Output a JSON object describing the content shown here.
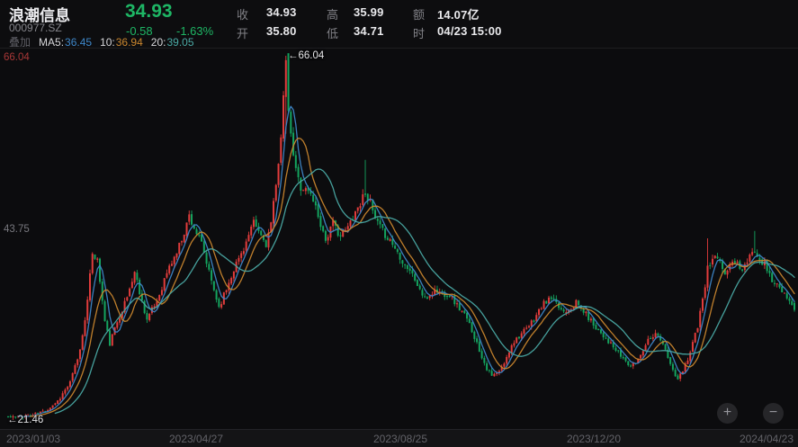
{
  "header": {
    "name": "浪潮信息",
    "code": "000977.SZ",
    "price": "34.93",
    "change": "-0.58",
    "change_pct": "-1.63%",
    "stats": {
      "close": {
        "label": "收",
        "value": "34.93"
      },
      "open": {
        "label": "开",
        "value": "35.80"
      },
      "high": {
        "label": "高",
        "value": "35.99"
      },
      "low": {
        "label": "低",
        "value": "34.71"
      },
      "amount": {
        "label": "额",
        "value": "14.07亿"
      },
      "time": {
        "label": "时",
        "value": "04/23 15:00"
      }
    },
    "ma": {
      "overlay": "叠加",
      "m5_label": "MA5:",
      "m5_value": "36.45",
      "m10_label": "10:",
      "m10_value": "36.94",
      "m20_label": "20:",
      "m20_value": "39.05"
    }
  },
  "controls": {
    "zoom_in": "+",
    "zoom_out": "−"
  },
  "theme": {
    "background": "#0c0c0e",
    "up_color": "#e23c3c",
    "down_color": "#14a45f",
    "price_green": "#1eb665",
    "axis_red": "#a83737",
    "axis_gray": "#626268"
  },
  "chart_data": {
    "type": "candlestick",
    "symbol": "000977.SZ",
    "title": "浪潮信息 daily K-line with MA5/MA10/MA20",
    "date_range": [
      "2023/01/03",
      "2024/04/23"
    ],
    "x_ticks": [
      "2023/01/03",
      "2023/04/27",
      "2023/08/25",
      "2023/12/20",
      "2024/04/23"
    ],
    "y_labels": {
      "max": "66.04",
      "mid": "43.75",
      "min": "21.46"
    },
    "annotations": {
      "high": "←66.04",
      "low": "←21.46"
    },
    "period_high": 66.04,
    "period_low": 21.46,
    "price_range": [
      21.46,
      66.04
    ],
    "days": 318,
    "seed": 11,
    "legend_position": "top-left",
    "grid": false,
    "anchors": [
      [
        0,
        21.9
      ],
      [
        4,
        21.8
      ],
      [
        10,
        22.1
      ],
      [
        15,
        22.6
      ],
      [
        20,
        23.8
      ],
      [
        25,
        26.0
      ],
      [
        29,
        30.0
      ],
      [
        32,
        36.0
      ],
      [
        34,
        42.0
      ],
      [
        36,
        41.0
      ],
      [
        39,
        33.5
      ],
      [
        41,
        30.8
      ],
      [
        44,
        33.5
      ],
      [
        48,
        36.5
      ],
      [
        51,
        39.6
      ],
      [
        54,
        36.0
      ],
      [
        56,
        33.8
      ],
      [
        60,
        36.0
      ],
      [
        64,
        39.5
      ],
      [
        68,
        42.0
      ],
      [
        71,
        44.5
      ],
      [
        73,
        46.5
      ],
      [
        75,
        45.0
      ],
      [
        78,
        43.0
      ],
      [
        81,
        39.5
      ],
      [
        85,
        35.3
      ],
      [
        88,
        37.5
      ],
      [
        91,
        40.0
      ],
      [
        95,
        42.5
      ],
      [
        99,
        45.5
      ],
      [
        101,
        44.5
      ],
      [
        104,
        43.0
      ],
      [
        106,
        45.5
      ],
      [
        108,
        50.0
      ],
      [
        110,
        56.5
      ],
      [
        111,
        61.0
      ],
      [
        112,
        65.5
      ],
      [
        113,
        59.5
      ],
      [
        114,
        56.0
      ],
      [
        116,
        52.0
      ],
      [
        118,
        50.0
      ],
      [
        121,
        49.5
      ],
      [
        123,
        48.5
      ],
      [
        125,
        46.5
      ],
      [
        128,
        43.5
      ],
      [
        131,
        45.5
      ],
      [
        134,
        44.0
      ],
      [
        137,
        45.0
      ],
      [
        139,
        46.5
      ],
      [
        142,
        48.0
      ],
      [
        144,
        49.5
      ],
      [
        146,
        48.0
      ],
      [
        148,
        46.0
      ],
      [
        151,
        44.5
      ],
      [
        154,
        43.5
      ],
      [
        157,
        42.0
      ],
      [
        160,
        40.5
      ],
      [
        162,
        39.8
      ],
      [
        165,
        38.0
      ],
      [
        168,
        36.2
      ],
      [
        172,
        37.3
      ],
      [
        175,
        37.0
      ],
      [
        178,
        36.8
      ],
      [
        181,
        35.5
      ],
      [
        184,
        34.3
      ],
      [
        187,
        32.5
      ],
      [
        190,
        30.0
      ],
      [
        193,
        27.8
      ],
      [
        195,
        26.8
      ],
      [
        198,
        27.3
      ],
      [
        201,
        29.0
      ],
      [
        203,
        30.8
      ],
      [
        206,
        31.8
      ],
      [
        209,
        32.5
      ],
      [
        212,
        33.8
      ],
      [
        215,
        35.3
      ],
      [
        217,
        36.0
      ],
      [
        219,
        36.3
      ],
      [
        221,
        35.5
      ],
      [
        224,
        34.8
      ],
      [
        227,
        35.3
      ],
      [
        229,
        35.8
      ],
      [
        232,
        34.8
      ],
      [
        234,
        34.0
      ],
      [
        236,
        33.2
      ],
      [
        238,
        32.5
      ],
      [
        241,
        31.5
      ],
      [
        244,
        30.3
      ],
      [
        247,
        29.3
      ],
      [
        251,
        28.0
      ],
      [
        253,
        28.5
      ],
      [
        255,
        29.5
      ],
      [
        257,
        30.8
      ],
      [
        259,
        31.8
      ],
      [
        262,
        32.0
      ],
      [
        264,
        30.8
      ],
      [
        266,
        29.0
      ],
      [
        268,
        27.5
      ],
      [
        270,
        26.3
      ],
      [
        272,
        27.5
      ],
      [
        274,
        29.0
      ],
      [
        276,
        31.0
      ],
      [
        278,
        33.0
      ],
      [
        280,
        36.0
      ],
      [
        282,
        40.0
      ],
      [
        284,
        41.0
      ],
      [
        285,
        41.5
      ],
      [
        287,
        40.5
      ],
      [
        289,
        39.5
      ],
      [
        291,
        40.3
      ],
      [
        293,
        41.0
      ],
      [
        295,
        40.3
      ],
      [
        296,
        39.8
      ],
      [
        298,
        40.8
      ],
      [
        301,
        42.3
      ],
      [
        303,
        41.3
      ],
      [
        305,
        40.5
      ],
      [
        307,
        39.3
      ],
      [
        308,
        38.5
      ],
      [
        310,
        38.0
      ],
      [
        312,
        37.0
      ],
      [
        314,
        36.3
      ],
      [
        315,
        35.8
      ],
      [
        316,
        35.5
      ],
      [
        317,
        34.93
      ]
    ],
    "key_candles": [
      {
        "day": 2,
        "l": 21.46
      },
      {
        "day": 112,
        "o": 61.0,
        "c": 65.5,
        "h": 66.04,
        "l": 56.5
      },
      {
        "day": 144,
        "h": 53.3
      },
      {
        "day": 282,
        "h": 43.7
      },
      {
        "day": 301,
        "h": 44.6
      },
      {
        "day": 317,
        "o": 35.8,
        "h": 35.99,
        "l": 34.71,
        "c": 34.93
      }
    ],
    "mas": [
      {
        "name": "MA5",
        "period": 5,
        "color": "#3e87c9",
        "current": 36.45
      },
      {
        "name": "MA10",
        "period": 10,
        "color": "#c9862e",
        "current": 36.94
      },
      {
        "name": "MA20",
        "period": 20,
        "color": "#4aa9a4",
        "current": 39.05
      }
    ],
    "colors": {
      "up": "#e23c3c",
      "down": "#14a45f"
    }
  }
}
